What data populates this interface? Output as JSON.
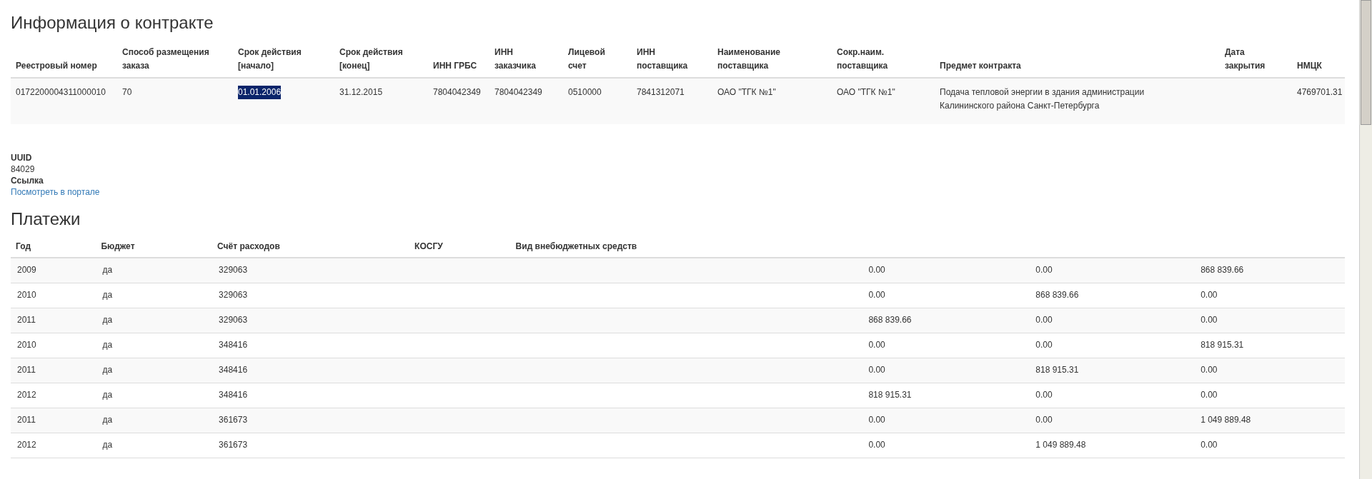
{
  "contract": {
    "title": "Информация о контракте",
    "columns": [
      "Реестровый номер",
      "Способ размещения заказа",
      "Срок действия [начало]",
      "Срок действия [конец]",
      "ИНН ГРБС",
      "ИНН заказчика",
      "Лицевой счет",
      "ИНН поставщика",
      "Наименование поставщика",
      "Сокр.наим. поставщика",
      "Предмет контракта",
      "Дата закрытия",
      "НМЦК"
    ],
    "rows": [
      {
        "cells": [
          {
            "text": "0172200004311000010",
            "selected": false
          },
          {
            "text": "70",
            "selected": false
          },
          {
            "text": "01.01.2006",
            "selected": true
          },
          {
            "text": "31.12.2015",
            "selected": false
          },
          {
            "text": "7804042349",
            "selected": false
          },
          {
            "text": "7804042349",
            "selected": false
          },
          {
            "text": "0510000",
            "selected": false
          },
          {
            "text": "7841312071",
            "selected": false
          },
          {
            "text": "ОАО \"ТГК №1\"",
            "selected": false
          },
          {
            "text": "ОАО \"ТГК №1\"",
            "selected": false
          },
          {
            "text": "Подача тепловой энергии в здания администрации Калининского района Санкт-Петербурга",
            "selected": false
          },
          {},
          {
            "text": "4769701.31",
            "selected": false
          }
        ]
      }
    ]
  },
  "details": [
    {
      "label": "UUID",
      "value": "84029",
      "kind": "text"
    },
    {
      "label": "Ссылка",
      "value": "Посмотреть в портале",
      "kind": "link"
    }
  ],
  "payments": {
    "title": "Платежи",
    "columns": [
      "Год",
      "Бюджет",
      "Счёт расходов",
      "КОСГУ",
      "Вид внебюджетных средств"
    ],
    "rows": [
      {
        "year": "2009",
        "budget": "да",
        "expense_account": "329063",
        "column_6": "0.00",
        "column_7": "0.00",
        "column_8": "868 839.66"
      },
      {
        "year": "2010",
        "budget": "да",
        "expense_account": "329063",
        "column_6": "0.00",
        "column_7": "868 839.66",
        "column_8": "0.00"
      },
      {
        "year": "2011",
        "budget": "да",
        "expense_account": "329063",
        "column_6": "868 839.66",
        "column_7": "0.00",
        "column_8": "0.00"
      },
      {
        "year": "2010",
        "budget": "да",
        "expense_account": "348416",
        "column_6": "0.00",
        "column_7": "0.00",
        "column_8": "818 915.31"
      },
      {
        "year": "2011",
        "budget": "да",
        "expense_account": "348416",
        "column_6": "0.00",
        "column_7": "818 915.31",
        "column_8": "0.00"
      },
      {
        "year": "2012",
        "budget": "да",
        "expense_account": "348416",
        "column_6": "818 915.31",
        "column_7": "0.00",
        "column_8": "0.00"
      },
      {
        "year": "2011",
        "budget": "да",
        "expense_account": "361673",
        "column_6": "0.00",
        "column_7": "0.00",
        "column_8": "1 049 889.48"
      },
      {
        "year": "2012",
        "budget": "да",
        "expense_account": "361673",
        "column_6": "0.00",
        "column_7": "1 049 889.48",
        "column_8": "0.00"
      }
    ]
  }
}
